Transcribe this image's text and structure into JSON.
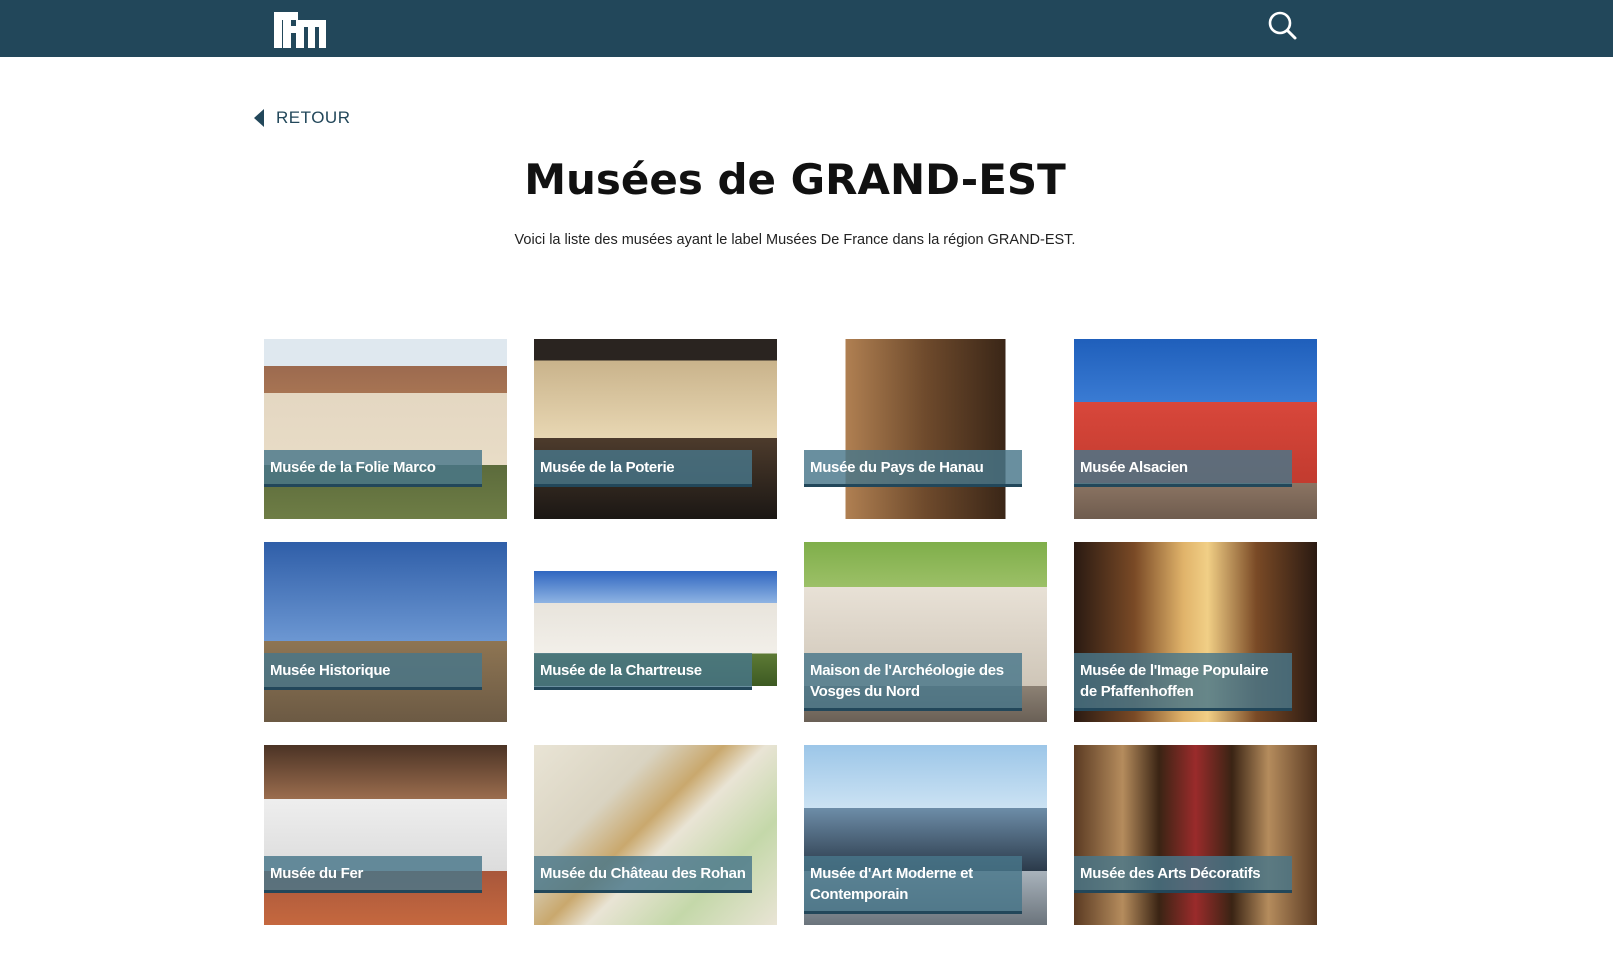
{
  "header": {
    "logo_icon": "hm-logo-icon",
    "search_icon": "search-icon",
    "bar_color": "#22475a"
  },
  "back_link": {
    "label": "RETOUR",
    "icon": "caret-left-icon"
  },
  "page": {
    "title": "Musées de GRAND-EST",
    "intro": "Voici la liste des musées ayant le label Musées De France dans la région GRAND-EST."
  },
  "museums": [
    {
      "name": "Musée de la Folie Marco"
    },
    {
      "name": "Musée de la Poterie"
    },
    {
      "name": "Musée du Pays de Hanau"
    },
    {
      "name": "Musée Alsacien"
    },
    {
      "name": "Musée Historique"
    },
    {
      "name": "Musée de la Chartreuse"
    },
    {
      "name": "Maison de l'Archéologie des Vosges du Nord"
    },
    {
      "name": "Musée de l'Image Populaire de Pfaffenhoffen"
    },
    {
      "name": "Musée du Fer"
    },
    {
      "name": "Musée du Château des Rohan"
    },
    {
      "name": "Musée d'Art Moderne et Contemporain"
    },
    {
      "name": "Musée des Arts Décoratifs"
    }
  ]
}
